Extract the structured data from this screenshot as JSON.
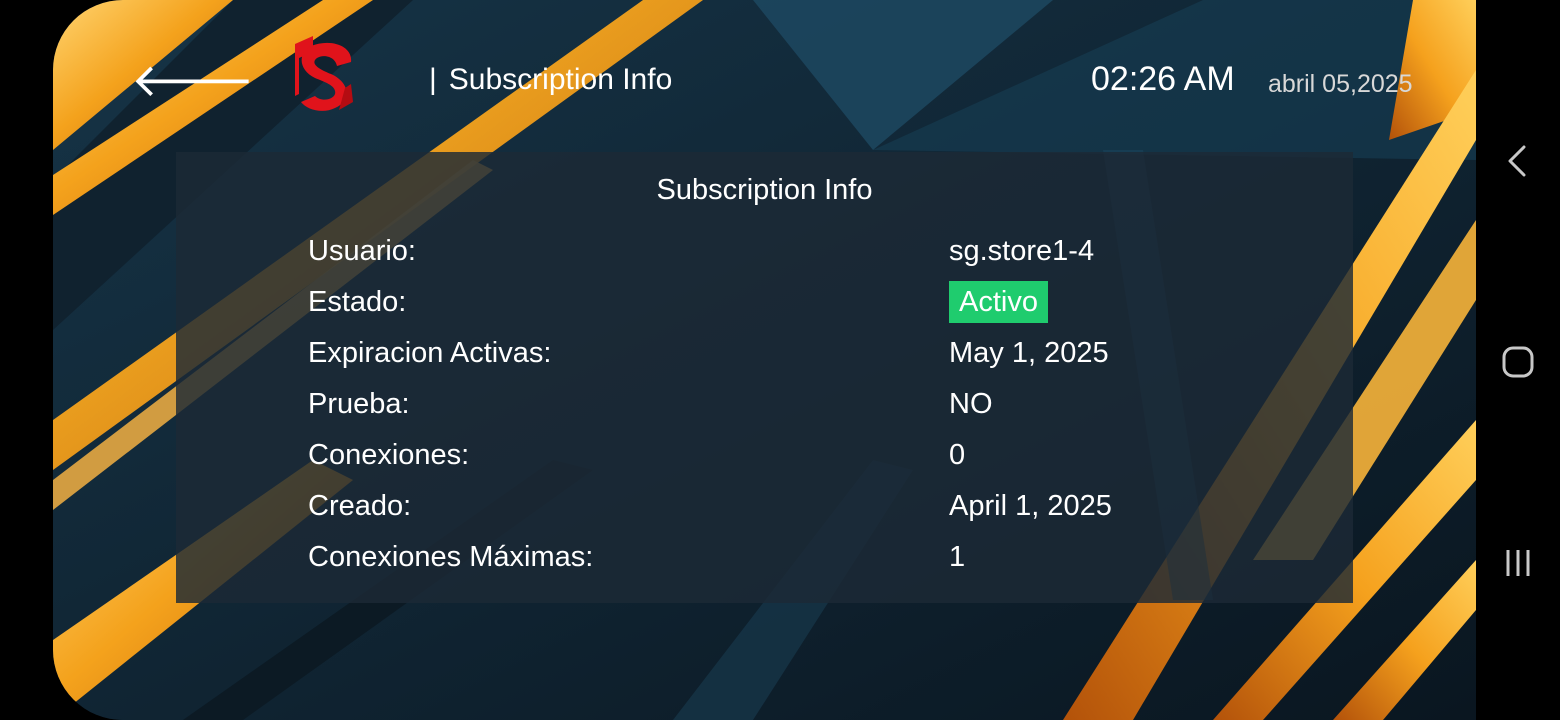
{
  "header": {
    "back_icon": "arrow-left-icon",
    "logo_icon": "brand-s-logo",
    "separator": "|",
    "title": "Subscription Info",
    "time": "02:26 AM",
    "date": "abril 05,2025"
  },
  "panel": {
    "title": "Subscription Info",
    "rows": [
      {
        "label": "Usuario:",
        "value": "sg.store1-4"
      },
      {
        "label": "Estado:",
        "value": "Activo"
      },
      {
        "label": "Expiracion Activas:",
        "value": "May 1, 2025"
      },
      {
        "label": "Prueba:",
        "value": "NO"
      },
      {
        "label": "Conexiones:",
        "value": "0"
      },
      {
        "label": "Creado:",
        "value": "April 1, 2025"
      },
      {
        "label": "Conexiones Máximas:",
        "value": "1"
      }
    ]
  },
  "system_nav": {
    "back_icon": "chevron-left-icon",
    "home_icon": "rounded-square-icon",
    "recents_icon": "three-bars-icon"
  },
  "colors": {
    "status_active": "#1fcc6e",
    "logo_red": "#e0131b",
    "background_dark": "#0d1b26",
    "gold": "#f5a623",
    "panel": "#1c2a36"
  }
}
